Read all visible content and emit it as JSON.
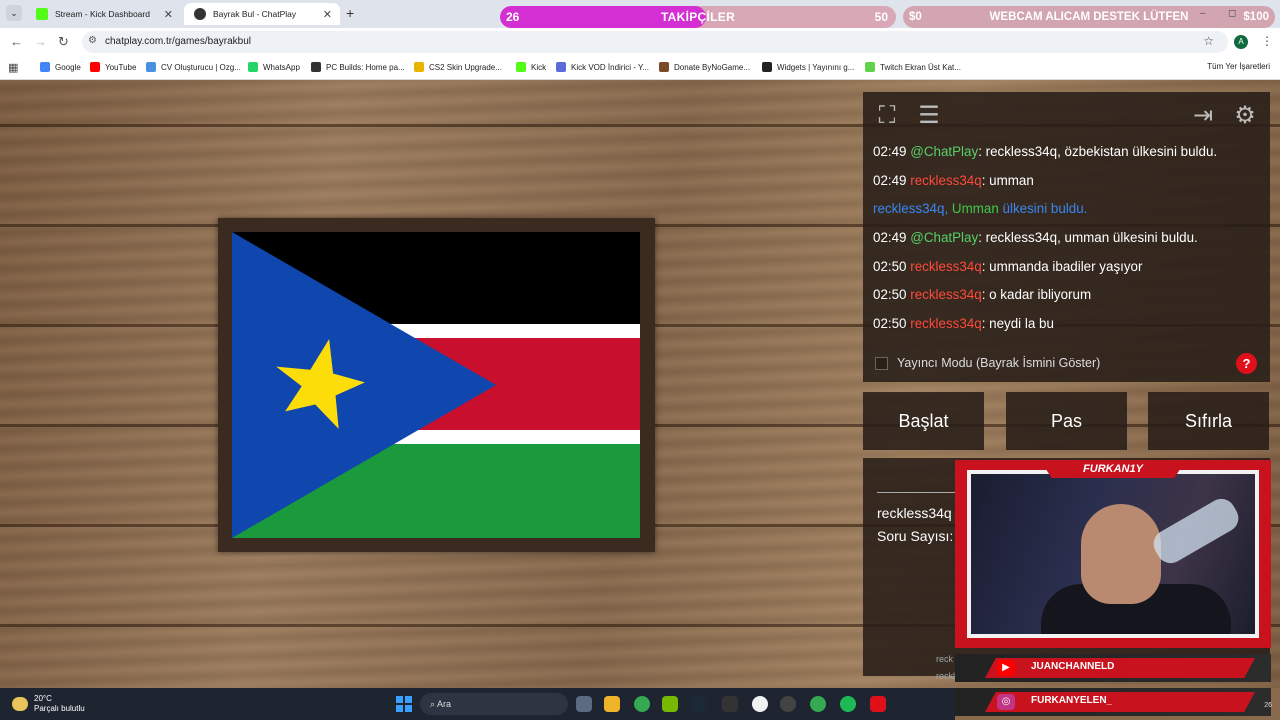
{
  "browser": {
    "tabs": [
      {
        "title": "Stream - Kick Dashboard",
        "active": false
      },
      {
        "title": "Bayrak Bul - ChatPlay",
        "active": true
      }
    ],
    "url": "chatplay.com.tr/games/bayrakbul",
    "profile_initial": "A",
    "bookmarks": [
      {
        "label": "Google",
        "color": "#4285f4"
      },
      {
        "label": "YouTube",
        "color": "#ff0000"
      },
      {
        "label": "CV Oluşturucu | Ozg...",
        "color": "#4a8fe0"
      },
      {
        "label": "WhatsApp",
        "color": "#25d366"
      },
      {
        "label": "PC Builds: Home pa...",
        "color": "#333333"
      },
      {
        "label": "CS2 Skin Upgrade...",
        "color": "#e8b400"
      },
      {
        "label": "Kick",
        "color": "#53fc18"
      },
      {
        "label": "Kick VOD İndirici - Y...",
        "color": "#5a6ad8"
      },
      {
        "label": "Donate ByNoGame...",
        "color": "#7a4a2a"
      },
      {
        "label": "Widgets | Yayınını g...",
        "color": "#222222"
      },
      {
        "label": "Twitch Ekran Üst Kat...",
        "color": "#5fd34a"
      }
    ],
    "all_bookmarks": "Tüm Yer İşaretleri"
  },
  "overlay": {
    "followers": {
      "current": "26",
      "label": "TAKİPÇİLER",
      "goal": "50",
      "progress": 0.52
    },
    "donation": {
      "current": "$0",
      "label": "WEBCAM ALICAM DESTEK LÜTFEN",
      "goal": "$100"
    }
  },
  "game": {
    "chat": [
      {
        "time": "02:49",
        "user": "@ChatPlay",
        "type": "bot",
        "text": ": reckless34q, özbekistan ülkesini buldu."
      },
      {
        "time": "02:49",
        "user": "reckless34q",
        "type": "user",
        "text": ": umman"
      },
      {
        "type": "system",
        "user": "reckless34q,",
        "answer": "Umman",
        "text": "ülkesini buldu."
      },
      {
        "time": "02:49",
        "user": "@ChatPlay",
        "type": "bot",
        "text": ": reckless34q, umman ülkesini buldu."
      },
      {
        "time": "02:50",
        "user": "reckless34q",
        "type": "user",
        "text": ": ummanda ibadiler yaşıyor"
      },
      {
        "time": "02:50",
        "user": "reckless34q",
        "type": "user",
        "text": ": o kadar ibliyorum"
      },
      {
        "time": "02:50",
        "user": "reckless34q",
        "type": "user",
        "text": ": neydi la bu"
      }
    ],
    "streamer_mode_label": "Yayıncı Modu (Bayrak İsmini Göster)",
    "help": "?",
    "buttons": {
      "start": "Başlat",
      "pass": "Pas",
      "reset": "Sıfırla"
    },
    "leaderboard": {
      "winner": "reckless34q",
      "question_count_label": "Soru Sayısı:"
    }
  },
  "webcam": {
    "name": "FURKAN1Y",
    "socials": [
      {
        "platform": "youtube-icon",
        "handle": "JUANCHANNELD",
        "color": "#ff0000"
      },
      {
        "platform": "instagram-icon",
        "handle": "FURKANYELEN_",
        "color": "#c13584"
      }
    ],
    "chat_peek": [
      "reck",
      "reckle"
    ]
  },
  "taskbar": {
    "temperature": "20°C",
    "weather": "Parçalı bulutlu",
    "search": "Ara",
    "clock": "26"
  }
}
